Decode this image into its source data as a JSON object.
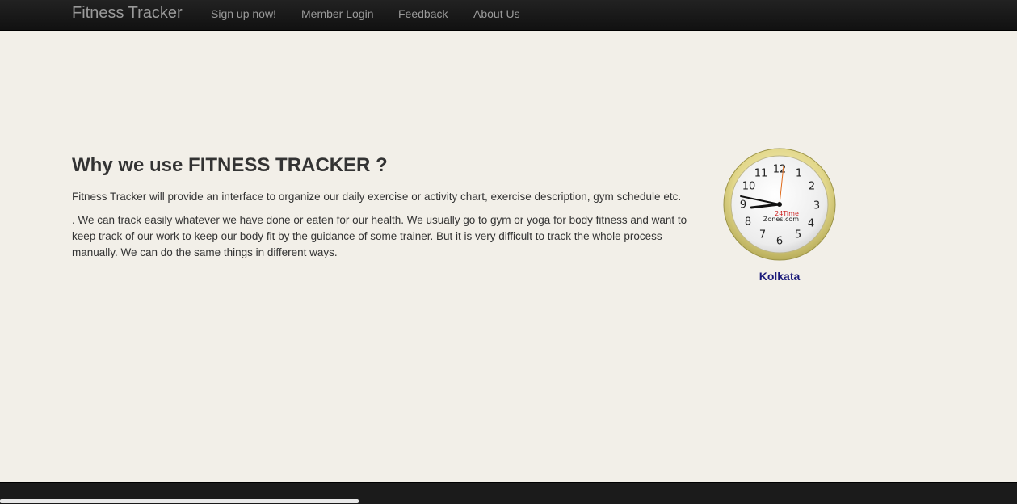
{
  "navbar": {
    "brand": "Fitness Tracker",
    "items": [
      {
        "label": "Sign up now!"
      },
      {
        "label": "Member Login"
      },
      {
        "label": "Feedback"
      },
      {
        "label": "About Us"
      }
    ]
  },
  "main": {
    "heading": "Why we use FITNESS TRACKER ?",
    "paragraphs": [
      "Fitness Tracker will provide an interface to organize our daily exercise or activity chart, exercise description, gym schedule etc.",
      ". We can track easily whatever we have done or eaten for our health. We usually go to gym or yoga for body fitness and want to keep track of our work to keep our body fit by the guidance of some trainer. But it is very difficult to track the whole process manually. We can do the same things in different ways."
    ]
  },
  "clock_widget": {
    "numbers": [
      "12",
      "1",
      "2",
      "3",
      "4",
      "5",
      "6",
      "7",
      "8",
      "9",
      "10",
      "11"
    ],
    "brand_line1": "24Time",
    "brand_line2": "Zones.com",
    "city": "Kolkata",
    "time": "9:47"
  },
  "colors": {
    "navbar": "#151515",
    "background": "#f2efe8",
    "city_link": "#1a1a7a",
    "clock_rim": "#d8cf7a"
  }
}
